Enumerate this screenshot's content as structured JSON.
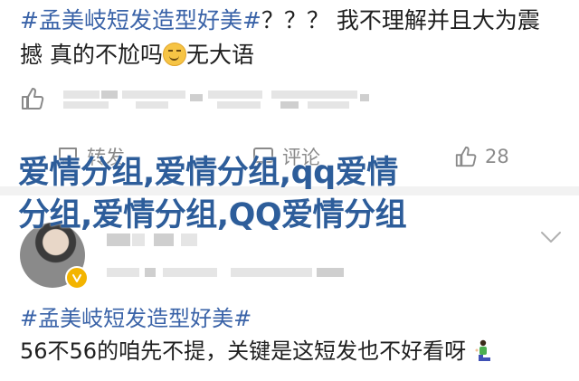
{
  "post1": {
    "hashtag": "#孟美岐短发造型好美#",
    "line1_rest": "？？？ 我不理解并且大为震",
    "line2": "撼 真的不尬吗",
    "line2_tail": "无大语",
    "emoji": "smirking-face"
  },
  "actions": {
    "repost_label": "转发",
    "comment_label": "评论",
    "like_count": "28"
  },
  "overlay": {
    "line1": "爱情分组,爱情分组,qq爱情",
    "line2": "分组,爱情分组,QQ爱情分组"
  },
  "post2": {
    "hashtag": "#孟美岐短发造型好美#",
    "text": "56不56的咱先不提，关键是这短发也不好看呀",
    "emoji": "person-kneeling"
  },
  "colors": {
    "hashtag": "#3a63a8",
    "overlay": "#2d5d9a",
    "icon_gray": "#8a8a8a",
    "verified": "#f3b400"
  }
}
